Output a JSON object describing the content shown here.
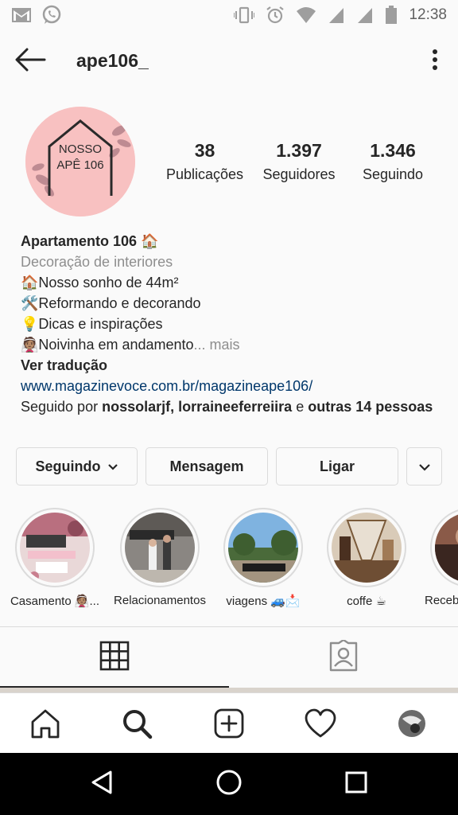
{
  "status_bar": {
    "time": "12:38",
    "left_icons": [
      "gmail-icon",
      "whatsapp-icon"
    ],
    "right_icons": [
      "vibrate-icon",
      "alarm-icon",
      "wifi-icon",
      "signal-icon",
      "signal-icon",
      "battery-icon"
    ]
  },
  "header": {
    "username": "ape106_",
    "back_icon": "arrow-left-icon",
    "menu_icon": "more-vertical-icon"
  },
  "profile": {
    "avatar_text_line1": "NOSSO",
    "avatar_text_line2": "APÊ 106",
    "stats": [
      {
        "value": "38",
        "label": "Publicações"
      },
      {
        "value": "1.397",
        "label": "Seguidores"
      },
      {
        "value": "1.346",
        "label": "Seguindo"
      }
    ]
  },
  "bio": {
    "name": "Apartamento 106 🏠",
    "category": "Decoração de interiores",
    "lines": [
      "🏠Nosso sonho de 44m²",
      "🛠️Reformando e decorando",
      "💡Dicas e inspirações",
      "👰🏽Noivinha em andamento"
    ],
    "more": "... mais",
    "translate": "Ver tradução",
    "link": "www.magazinevoce.com.br/magazineape106/",
    "followed_prefix": "Seguido por ",
    "followed_users": "nossolarjf, lorraineeferreiira",
    "followed_and": " e ",
    "followed_others": "outras 14 pessoas"
  },
  "actions": {
    "following": "Seguindo",
    "message": "Mensagem",
    "call": "Ligar"
  },
  "highlights": [
    {
      "caption": "Casamento 👰🏽...",
      "bg": "#c9a1a6"
    },
    {
      "caption": "Relacionamentos",
      "bg": "#6b6864"
    },
    {
      "caption": "viagens 🚙📩",
      "bg": "#5b8bbd"
    },
    {
      "caption": "coffe ☕",
      "bg": "#b89a7c"
    },
    {
      "caption": "Receb",
      "bg": "#7a4a3a"
    }
  ],
  "tabs": [
    "grid-icon",
    "tagged-icon"
  ],
  "bottom_nav": [
    "home-icon",
    "search-icon",
    "add-post-icon",
    "heart-icon",
    "profile-avatar"
  ],
  "system_nav": [
    "back-triangle-icon",
    "home-circle-icon",
    "recents-square-icon"
  ],
  "colors": {
    "link": "#00376b",
    "muted": "#8e8e8e",
    "border": "#dbdbdb",
    "avatar_bg": "#f8c1c1"
  }
}
